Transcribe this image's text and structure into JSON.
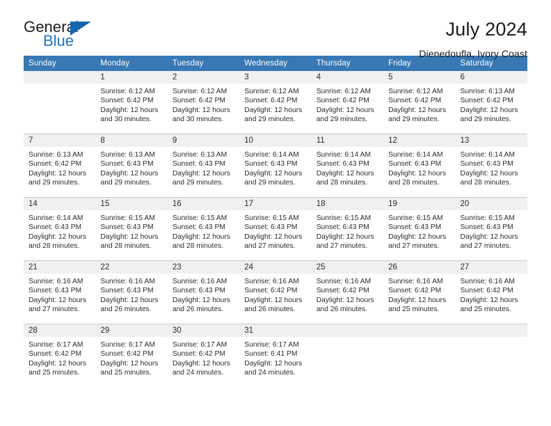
{
  "brand": {
    "word_one": "General",
    "word_two": "Blue",
    "triangle_icon": "triangle-icon"
  },
  "header": {
    "title": "July 2024",
    "subtitle": "Dienedoufla, Ivory Coast"
  },
  "colors": {
    "header_blue": "#3878b4",
    "brand_blue": "#2175c0",
    "daynum_band": "#f0f0f0",
    "row_divider": "#c8c8c8"
  },
  "weekday_headers": [
    "Sunday",
    "Monday",
    "Tuesday",
    "Wednesday",
    "Thursday",
    "Friday",
    "Saturday"
  ],
  "labels": {
    "sunrise_prefix": "Sunrise:",
    "sunset_prefix": "Sunset:",
    "daylight_prefix": "Daylight:"
  },
  "weeks": [
    [
      {
        "day": "",
        "sunrise": "",
        "sunset": "",
        "daylight_line1": "",
        "daylight_line2": ""
      },
      {
        "day": "1",
        "sunrise": "Sunrise: 6:12 AM",
        "sunset": "Sunset: 6:42 PM",
        "daylight_line1": "Daylight: 12 hours",
        "daylight_line2": "and 30 minutes."
      },
      {
        "day": "2",
        "sunrise": "Sunrise: 6:12 AM",
        "sunset": "Sunset: 6:42 PM",
        "daylight_line1": "Daylight: 12 hours",
        "daylight_line2": "and 30 minutes."
      },
      {
        "day": "3",
        "sunrise": "Sunrise: 6:12 AM",
        "sunset": "Sunset: 6:42 PM",
        "daylight_line1": "Daylight: 12 hours",
        "daylight_line2": "and 29 minutes."
      },
      {
        "day": "4",
        "sunrise": "Sunrise: 6:12 AM",
        "sunset": "Sunset: 6:42 PM",
        "daylight_line1": "Daylight: 12 hours",
        "daylight_line2": "and 29 minutes."
      },
      {
        "day": "5",
        "sunrise": "Sunrise: 6:12 AM",
        "sunset": "Sunset: 6:42 PM",
        "daylight_line1": "Daylight: 12 hours",
        "daylight_line2": "and 29 minutes."
      },
      {
        "day": "6",
        "sunrise": "Sunrise: 6:13 AM",
        "sunset": "Sunset: 6:42 PM",
        "daylight_line1": "Daylight: 12 hours",
        "daylight_line2": "and 29 minutes."
      }
    ],
    [
      {
        "day": "7",
        "sunrise": "Sunrise: 6:13 AM",
        "sunset": "Sunset: 6:42 PM",
        "daylight_line1": "Daylight: 12 hours",
        "daylight_line2": "and 29 minutes."
      },
      {
        "day": "8",
        "sunrise": "Sunrise: 6:13 AM",
        "sunset": "Sunset: 6:43 PM",
        "daylight_line1": "Daylight: 12 hours",
        "daylight_line2": "and 29 minutes."
      },
      {
        "day": "9",
        "sunrise": "Sunrise: 6:13 AM",
        "sunset": "Sunset: 6:43 PM",
        "daylight_line1": "Daylight: 12 hours",
        "daylight_line2": "and 29 minutes."
      },
      {
        "day": "10",
        "sunrise": "Sunrise: 6:14 AM",
        "sunset": "Sunset: 6:43 PM",
        "daylight_line1": "Daylight: 12 hours",
        "daylight_line2": "and 29 minutes."
      },
      {
        "day": "11",
        "sunrise": "Sunrise: 6:14 AM",
        "sunset": "Sunset: 6:43 PM",
        "daylight_line1": "Daylight: 12 hours",
        "daylight_line2": "and 28 minutes."
      },
      {
        "day": "12",
        "sunrise": "Sunrise: 6:14 AM",
        "sunset": "Sunset: 6:43 PM",
        "daylight_line1": "Daylight: 12 hours",
        "daylight_line2": "and 28 minutes."
      },
      {
        "day": "13",
        "sunrise": "Sunrise: 6:14 AM",
        "sunset": "Sunset: 6:43 PM",
        "daylight_line1": "Daylight: 12 hours",
        "daylight_line2": "and 28 minutes."
      }
    ],
    [
      {
        "day": "14",
        "sunrise": "Sunrise: 6:14 AM",
        "sunset": "Sunset: 6:43 PM",
        "daylight_line1": "Daylight: 12 hours",
        "daylight_line2": "and 28 minutes."
      },
      {
        "day": "15",
        "sunrise": "Sunrise: 6:15 AM",
        "sunset": "Sunset: 6:43 PM",
        "daylight_line1": "Daylight: 12 hours",
        "daylight_line2": "and 28 minutes."
      },
      {
        "day": "16",
        "sunrise": "Sunrise: 6:15 AM",
        "sunset": "Sunset: 6:43 PM",
        "daylight_line1": "Daylight: 12 hours",
        "daylight_line2": "and 28 minutes."
      },
      {
        "day": "17",
        "sunrise": "Sunrise: 6:15 AM",
        "sunset": "Sunset: 6:43 PM",
        "daylight_line1": "Daylight: 12 hours",
        "daylight_line2": "and 27 minutes."
      },
      {
        "day": "18",
        "sunrise": "Sunrise: 6:15 AM",
        "sunset": "Sunset: 6:43 PM",
        "daylight_line1": "Daylight: 12 hours",
        "daylight_line2": "and 27 minutes."
      },
      {
        "day": "19",
        "sunrise": "Sunrise: 6:15 AM",
        "sunset": "Sunset: 6:43 PM",
        "daylight_line1": "Daylight: 12 hours",
        "daylight_line2": "and 27 minutes."
      },
      {
        "day": "20",
        "sunrise": "Sunrise: 6:15 AM",
        "sunset": "Sunset: 6:43 PM",
        "daylight_line1": "Daylight: 12 hours",
        "daylight_line2": "and 27 minutes."
      }
    ],
    [
      {
        "day": "21",
        "sunrise": "Sunrise: 6:16 AM",
        "sunset": "Sunset: 6:43 PM",
        "daylight_line1": "Daylight: 12 hours",
        "daylight_line2": "and 27 minutes."
      },
      {
        "day": "22",
        "sunrise": "Sunrise: 6:16 AM",
        "sunset": "Sunset: 6:43 PM",
        "daylight_line1": "Daylight: 12 hours",
        "daylight_line2": "and 26 minutes."
      },
      {
        "day": "23",
        "sunrise": "Sunrise: 6:16 AM",
        "sunset": "Sunset: 6:43 PM",
        "daylight_line1": "Daylight: 12 hours",
        "daylight_line2": "and 26 minutes."
      },
      {
        "day": "24",
        "sunrise": "Sunrise: 6:16 AM",
        "sunset": "Sunset: 6:42 PM",
        "daylight_line1": "Daylight: 12 hours",
        "daylight_line2": "and 26 minutes."
      },
      {
        "day": "25",
        "sunrise": "Sunrise: 6:16 AM",
        "sunset": "Sunset: 6:42 PM",
        "daylight_line1": "Daylight: 12 hours",
        "daylight_line2": "and 26 minutes."
      },
      {
        "day": "26",
        "sunrise": "Sunrise: 6:16 AM",
        "sunset": "Sunset: 6:42 PM",
        "daylight_line1": "Daylight: 12 hours",
        "daylight_line2": "and 25 minutes."
      },
      {
        "day": "27",
        "sunrise": "Sunrise: 6:16 AM",
        "sunset": "Sunset: 6:42 PM",
        "daylight_line1": "Daylight: 12 hours",
        "daylight_line2": "and 25 minutes."
      }
    ],
    [
      {
        "day": "28",
        "sunrise": "Sunrise: 6:17 AM",
        "sunset": "Sunset: 6:42 PM",
        "daylight_line1": "Daylight: 12 hours",
        "daylight_line2": "and 25 minutes."
      },
      {
        "day": "29",
        "sunrise": "Sunrise: 6:17 AM",
        "sunset": "Sunset: 6:42 PM",
        "daylight_line1": "Daylight: 12 hours",
        "daylight_line2": "and 25 minutes."
      },
      {
        "day": "30",
        "sunrise": "Sunrise: 6:17 AM",
        "sunset": "Sunset: 6:42 PM",
        "daylight_line1": "Daylight: 12 hours",
        "daylight_line2": "and 24 minutes."
      },
      {
        "day": "31",
        "sunrise": "Sunrise: 6:17 AM",
        "sunset": "Sunset: 6:41 PM",
        "daylight_line1": "Daylight: 12 hours",
        "daylight_line2": "and 24 minutes."
      },
      {
        "day": "",
        "sunrise": "",
        "sunset": "",
        "daylight_line1": "",
        "daylight_line2": ""
      },
      {
        "day": "",
        "sunrise": "",
        "sunset": "",
        "daylight_line1": "",
        "daylight_line2": ""
      },
      {
        "day": "",
        "sunrise": "",
        "sunset": "",
        "daylight_line1": "",
        "daylight_line2": ""
      }
    ]
  ]
}
